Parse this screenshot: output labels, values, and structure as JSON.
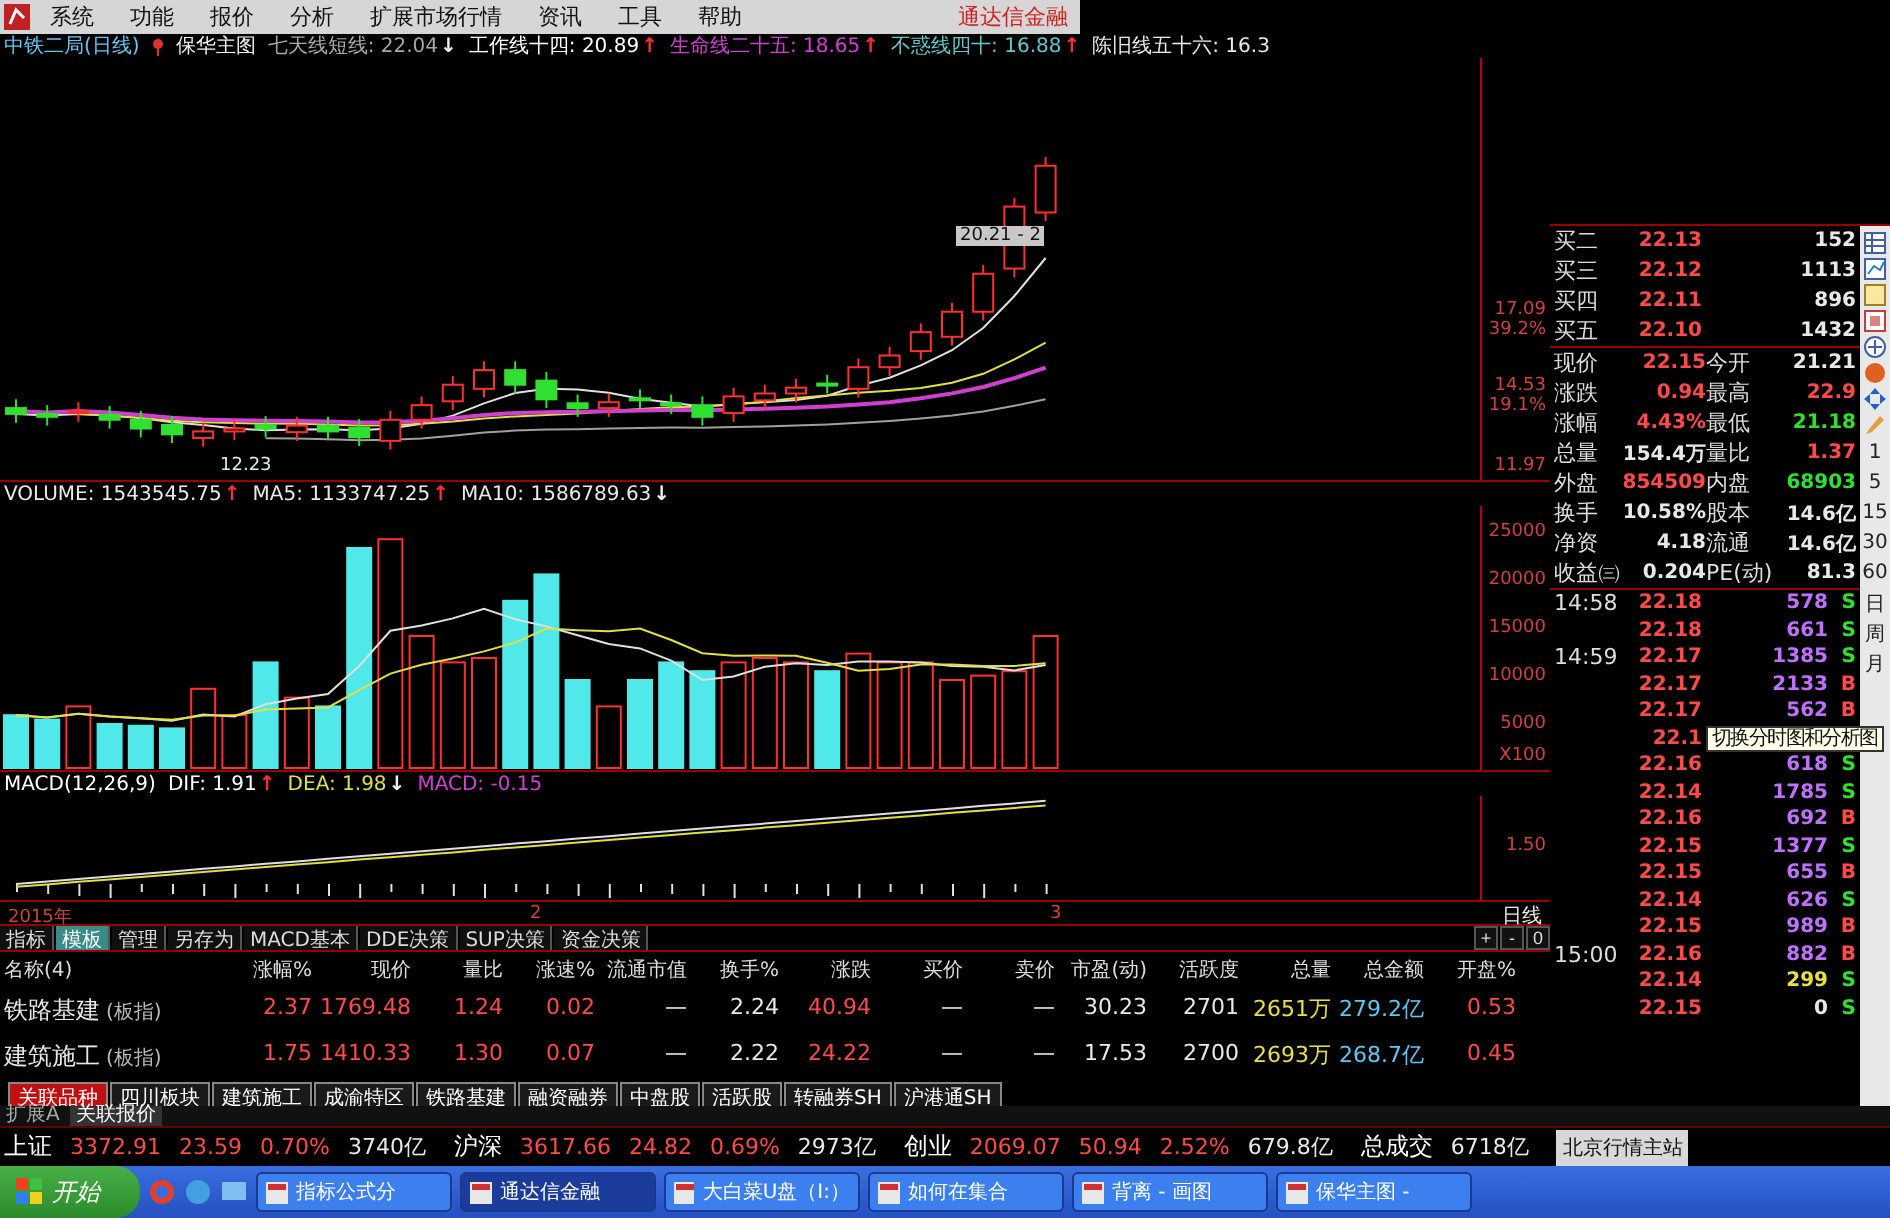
{
  "menu": {
    "items": [
      "系统",
      "功能",
      "报价",
      "分析",
      "扩展市场行情",
      "资讯",
      "工具",
      "帮助"
    ],
    "brand": "通达信金融"
  },
  "indicator_line": {
    "title": "中铁二局(日线)",
    "formula": "保华主图",
    "lines": [
      {
        "text": "七天线短线: 22.04",
        "arrow": "↓",
        "color": "#a8a8a8"
      },
      {
        "text": "工作线十四: 20.89",
        "arrow": "↑",
        "color": "#ffffff"
      },
      {
        "text": "生命线二十五: 18.65",
        "arrow": "↑",
        "color": "#d040d0"
      },
      {
        "text": "不惑线四十: 16.88",
        "arrow": "↑",
        "color": "#60c8c8"
      },
      {
        "text": "陈旧线五十六: 16.3",
        "color": "#e8e8e8"
      }
    ]
  },
  "price_chart": {
    "high_label": "20.21 - 2",
    "low_label": "12.23",
    "axis": [
      "17.09",
      "39.2%",
      "14.53",
      "19.1%",
      "11.97"
    ]
  },
  "volume_chart": {
    "lines": [
      {
        "text": "VOLUME: 1543545.75",
        "arrow": "↑"
      },
      {
        "text": "MA5: 1133747.25",
        "arrow": "↑"
      },
      {
        "text": "MA10: 1586789.63",
        "arrow": "↓"
      }
    ],
    "axis": [
      "25000",
      "20000",
      "15000",
      "10000",
      "5000"
    ],
    "unit": "X100"
  },
  "macd_chart": {
    "lines": [
      {
        "text": "MACD(12,26,9)",
        "color": "#ffffff"
      },
      {
        "text": "DIF: 1.91",
        "arrow": "↑",
        "color": "#ffffff"
      },
      {
        "text": "DEA: 1.98",
        "arrow": "↓",
        "color": "#e0e040"
      },
      {
        "text": "MACD: -0.15",
        "color": "#d040d0"
      }
    ],
    "axis": [
      "1.50"
    ]
  },
  "date_axis": {
    "labels": [
      "2015年",
      "2",
      "3"
    ],
    "period": "日线"
  },
  "indicator_tabs": [
    {
      "label": "指标",
      "selected": false
    },
    {
      "label": "模板",
      "selected": true
    },
    {
      "label": "管理",
      "selected": false
    },
    {
      "label": "另存为",
      "selected": false
    },
    {
      "label": "MACD基本",
      "selected": false
    },
    {
      "label": "DDE决策",
      "selected": false
    },
    {
      "label": "SUP决策",
      "selected": false
    },
    {
      "label": "资金决策",
      "selected": false
    }
  ],
  "zoom_buttons": [
    "+",
    "-",
    "0"
  ],
  "table": {
    "columns": [
      "名称(4)",
      "涨幅%",
      "现价",
      "量比",
      "涨速%",
      "流通市值",
      "换手%",
      "涨跌",
      "买价",
      "卖价",
      "市盈(动)",
      "活跃度",
      "总量",
      "总金额",
      "开盘%"
    ],
    "rows": [
      {
        "cells": [
          {
            "text": "铁路基建",
            "tag": "(板指)",
            "kind": "name"
          },
          {
            "text": "2.37",
            "color": "#ff4a4a"
          },
          {
            "text": "1769.48",
            "color": "#ff4a4a"
          },
          {
            "text": "1.24",
            "color": "#ff4a4a"
          },
          {
            "text": "0.02",
            "color": "#ff4a4a"
          },
          {
            "text": "—"
          },
          {
            "text": "2.24",
            "color": "#e8e8e8"
          },
          {
            "text": "40.94",
            "color": "#ff4a4a"
          },
          {
            "text": "—"
          },
          {
            "text": "—"
          },
          {
            "text": "30.23",
            "color": "#e8e8e8"
          },
          {
            "text": "2701",
            "color": "#e8e8e8"
          },
          {
            "text": "2651万",
            "color": "#e8e040"
          },
          {
            "text": "279.2亿",
            "color": "#60c8f0"
          },
          {
            "text": "0.53",
            "color": "#ff4a4a"
          }
        ]
      },
      {
        "cells": [
          {
            "text": "建筑施工",
            "tag": "(板指)",
            "kind": "name"
          },
          {
            "text": "1.75",
            "color": "#ff4a4a"
          },
          {
            "text": "1410.33",
            "color": "#ff4a4a"
          },
          {
            "text": "1.30",
            "color": "#ff4a4a"
          },
          {
            "text": "0.07",
            "color": "#ff4a4a"
          },
          {
            "text": "—"
          },
          {
            "text": "2.22",
            "color": "#e8e8e8"
          },
          {
            "text": "24.22",
            "color": "#ff4a4a"
          },
          {
            "text": "—"
          },
          {
            "text": "—"
          },
          {
            "text": "17.53",
            "color": "#e8e8e8"
          },
          {
            "text": "2700",
            "color": "#e8e8e8"
          },
          {
            "text": "2693万",
            "color": "#e8e040"
          },
          {
            "text": "268.7亿",
            "color": "#60c8f0"
          },
          {
            "text": "0.45",
            "color": "#ff4a4a"
          }
        ]
      }
    ]
  },
  "sector_tabs": [
    {
      "label": "关联品种",
      "selected": true
    },
    {
      "label": "四川板块",
      "selected": false
    },
    {
      "label": "建筑施工",
      "selected": false
    },
    {
      "label": "成渝特区",
      "selected": false
    },
    {
      "label": "铁路基建",
      "selected": false
    },
    {
      "label": "融资融券",
      "selected": false
    },
    {
      "label": "中盘股",
      "selected": false
    },
    {
      "label": "活跃股",
      "selected": false
    },
    {
      "label": "转融券SH",
      "selected": false
    },
    {
      "label": "沪港通SH",
      "selected": false
    }
  ],
  "bottom_tabs": [
    {
      "label": "扩展A",
      "selected": false
    },
    {
      "label": "关联报价",
      "selected": true
    }
  ],
  "quote_panel": {
    "order_book": [
      {
        "label": "买二",
        "price": "22.13",
        "volume": "152"
      },
      {
        "label": "买三",
        "price": "22.12",
        "volume": "1113"
      },
      {
        "label": "买四",
        "price": "22.11",
        "volume": "896"
      },
      {
        "label": "买五",
        "price": "22.10",
        "volume": "1432"
      }
    ],
    "stats": [
      [
        {
          "label": "现价",
          "value": "22.15",
          "color": "#ff4a4a"
        },
        {
          "label": "今开",
          "value": "21.21",
          "color": "#e8e8e8"
        }
      ],
      [
        {
          "label": "涨跌",
          "value": "0.94",
          "color": "#ff4a4a"
        },
        {
          "label": "最高",
          "value": "22.9",
          "color": "#ff4a4a"
        }
      ],
      [
        {
          "label": "涨幅",
          "value": "4.43%",
          "color": "#ff4a4a"
        },
        {
          "label": "最低",
          "value": "21.18",
          "color": "#30e030"
        }
      ],
      [
        {
          "label": "总量",
          "value": "154.4万",
          "color": "#e8e8e8"
        },
        {
          "label": "量比",
          "value": "1.37",
          "color": "#ff4a4a"
        }
      ],
      [
        {
          "label": "外盘",
          "value": "854509",
          "color": "#ff4a4a"
        },
        {
          "label": "内盘",
          "value": "68903",
          "color": "#30e030"
        }
      ],
      [
        {
          "label": "换手",
          "value": "10.58%",
          "color": "#e8e8e8"
        },
        {
          "label": "股本",
          "value": "14.6亿",
          "color": "#e8e8e8"
        }
      ],
      [
        {
          "label": "净资",
          "value": "4.18",
          "color": "#e8e8e8"
        },
        {
          "label": "流通",
          "value": "14.6亿",
          "color": "#e8e8e8"
        }
      ],
      [
        {
          "label": "收益㈢",
          "value": "0.204",
          "color": "#e8e8e8"
        },
        {
          "label": "PE(动)",
          "value": "81.3",
          "color": "#e8e8e8"
        }
      ]
    ],
    "ticks": [
      {
        "time": "14:58",
        "price": "22.18",
        "volume": "578",
        "color": "#c070ff",
        "side": "S"
      },
      {
        "price": "22.18",
        "volume": "661",
        "color": "#c070ff",
        "side": "S"
      },
      {
        "time": "14:59",
        "price": "22.17",
        "volume": "1385",
        "color": "#c070ff",
        "side": "S"
      },
      {
        "price": "22.17",
        "volume": "2133",
        "color": "#c070ff",
        "side": "B"
      },
      {
        "price": "22.17",
        "volume": "562",
        "color": "#c070ff",
        "side": "B"
      },
      {
        "price": "22.1"
      },
      {
        "price": "22.16",
        "volume": "618",
        "color": "#c070ff",
        "side": "S"
      },
      {
        "price": "22.14",
        "volume": "1785",
        "color": "#c070ff",
        "side": "S"
      },
      {
        "price": "22.16",
        "volume": "692",
        "color": "#c070ff",
        "side": "B"
      },
      {
        "price": "22.15",
        "volume": "1377",
        "color": "#c070ff",
        "side": "S"
      },
      {
        "price": "22.15",
        "volume": "655",
        "color": "#c070ff",
        "side": "B"
      },
      {
        "price": "22.14",
        "volume": "626",
        "color": "#c070ff",
        "side": "S"
      },
      {
        "price": "22.15",
        "volume": "989",
        "color": "#c070ff",
        "side": "B"
      },
      {
        "time": "15:00",
        "price": "22.16",
        "volume": "882",
        "color": "#c070ff",
        "side": "B"
      },
      {
        "price": "22.14",
        "volume": "299",
        "color": "#e8e040",
        "side": "S"
      },
      {
        "price": "22.15",
        "volume": "0",
        "color": "#e8e8e8",
        "side": "S"
      }
    ]
  },
  "toolbar": {
    "periods": [
      "1",
      "5",
      "15",
      "30",
      "60",
      "日",
      "周",
      "月"
    ],
    "tooltip": "切换分时图和分析图"
  },
  "ticker": [
    {
      "name": "上证",
      "values": [
        {
          "text": "3372.91",
          "color": "#ff4a4a"
        },
        {
          "text": "23.59",
          "color": "#ff4a4a"
        },
        {
          "text": "0.70%",
          "color": "#ff4a4a"
        },
        {
          "text": "3740亿",
          "color": "#e8e8e8"
        }
      ]
    },
    {
      "name": "沪深",
      "values": [
        {
          "text": "3617.66",
          "color": "#ff4a4a"
        },
        {
          "text": "24.82",
          "color": "#ff4a4a"
        },
        {
          "text": "0.69%",
          "color": "#ff4a4a"
        },
        {
          "text": "2973亿",
          "color": "#e8e8e8"
        }
      ]
    },
    {
      "name": "创业",
      "values": [
        {
          "text": "2069.07",
          "color": "#ff4a4a"
        },
        {
          "text": "50.94",
          "color": "#ff4a4a"
        },
        {
          "text": "2.52%",
          "color": "#ff4a4a"
        },
        {
          "text": "679.8亿",
          "color": "#e8e8e8"
        }
      ]
    },
    {
      "name": "总成交",
      "values": [
        {
          "text": "6718亿",
          "color": "#e8e8e8"
        }
      ]
    }
  ],
  "server": "北京行情主站",
  "taskbar": {
    "start": "开始",
    "tasks": [
      {
        "label": "指标公式分",
        "selected": false
      },
      {
        "label": "通达信金融",
        "selected": true
      },
      {
        "label": "大白菜U盘（I:）",
        "selected": false
      },
      {
        "label": "如何在集合",
        "selected": false
      },
      {
        "label": "背离 - 画图",
        "selected": false
      },
      {
        "label": "保华主图 -",
        "selected": false
      }
    ]
  }
}
